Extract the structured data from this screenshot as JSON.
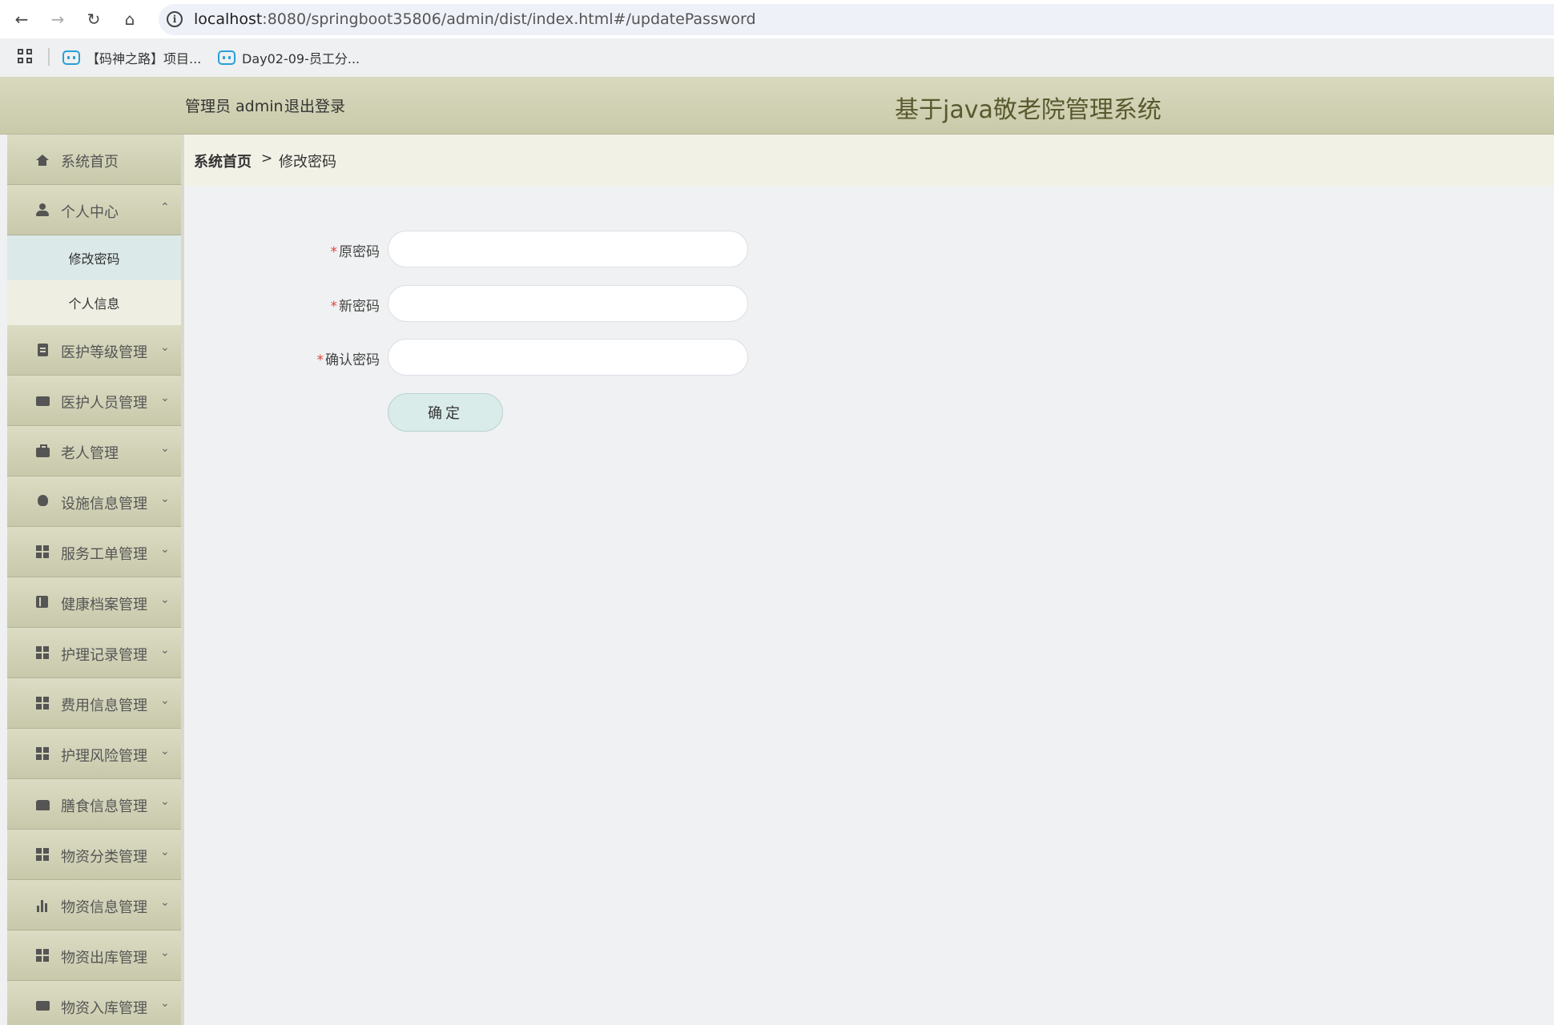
{
  "browser": {
    "url_host": "localhost",
    "url_path": ":8080/springboot35806/admin/dist/index.html#/updatePassword",
    "bookmarks": [
      {
        "label": "【码神之路】项目..."
      },
      {
        "label": "Day02-09-员工分..."
      }
    ]
  },
  "header": {
    "user_info": "管理员 admin",
    "logout": "退出登录",
    "title": "基于java敬老院管理系统"
  },
  "sidebar": {
    "items": [
      {
        "label": "系统首页",
        "icon": "home-icon"
      },
      {
        "label": "个人中心",
        "icon": "user-icon",
        "expanded": true,
        "children": [
          {
            "label": "修改密码",
            "active": true
          },
          {
            "label": "个人信息",
            "active": false
          }
        ]
      },
      {
        "label": "医护等级管理",
        "icon": "clipboard-icon"
      },
      {
        "label": "医护人员管理",
        "icon": "wallet-icon"
      },
      {
        "label": "老人管理",
        "icon": "briefcase-icon"
      },
      {
        "label": "设施信息管理",
        "icon": "bulb-icon"
      },
      {
        "label": "服务工单管理",
        "icon": "grid-icon"
      },
      {
        "label": "健康档案管理",
        "icon": "book-icon"
      },
      {
        "label": "护理记录管理",
        "icon": "grid-icon"
      },
      {
        "label": "费用信息管理",
        "icon": "grid-icon"
      },
      {
        "label": "护理风险管理",
        "icon": "grid-icon"
      },
      {
        "label": "膳食信息管理",
        "icon": "cart-icon"
      },
      {
        "label": "物资分类管理",
        "icon": "grid-icon"
      },
      {
        "label": "物资信息管理",
        "icon": "bar-chart-icon"
      },
      {
        "label": "物资出库管理",
        "icon": "grid-icon"
      },
      {
        "label": "物资入库管理",
        "icon": "chat-icon"
      }
    ]
  },
  "breadcrumb": {
    "home": "系统首页",
    "separator": ">",
    "current": "修改密码"
  },
  "form": {
    "required_mark": "*",
    "old_password_label": "原密码",
    "new_password_label": "新密码",
    "confirm_password_label": "确认密码",
    "old_password_value": "",
    "new_password_value": "",
    "confirm_password_value": "",
    "submit_label": "确定"
  },
  "colors": {
    "header_bg": "#d4d4b8",
    "title_color": "#59592f",
    "required": "#e0453c",
    "submit_bg": "#d9ecea"
  }
}
